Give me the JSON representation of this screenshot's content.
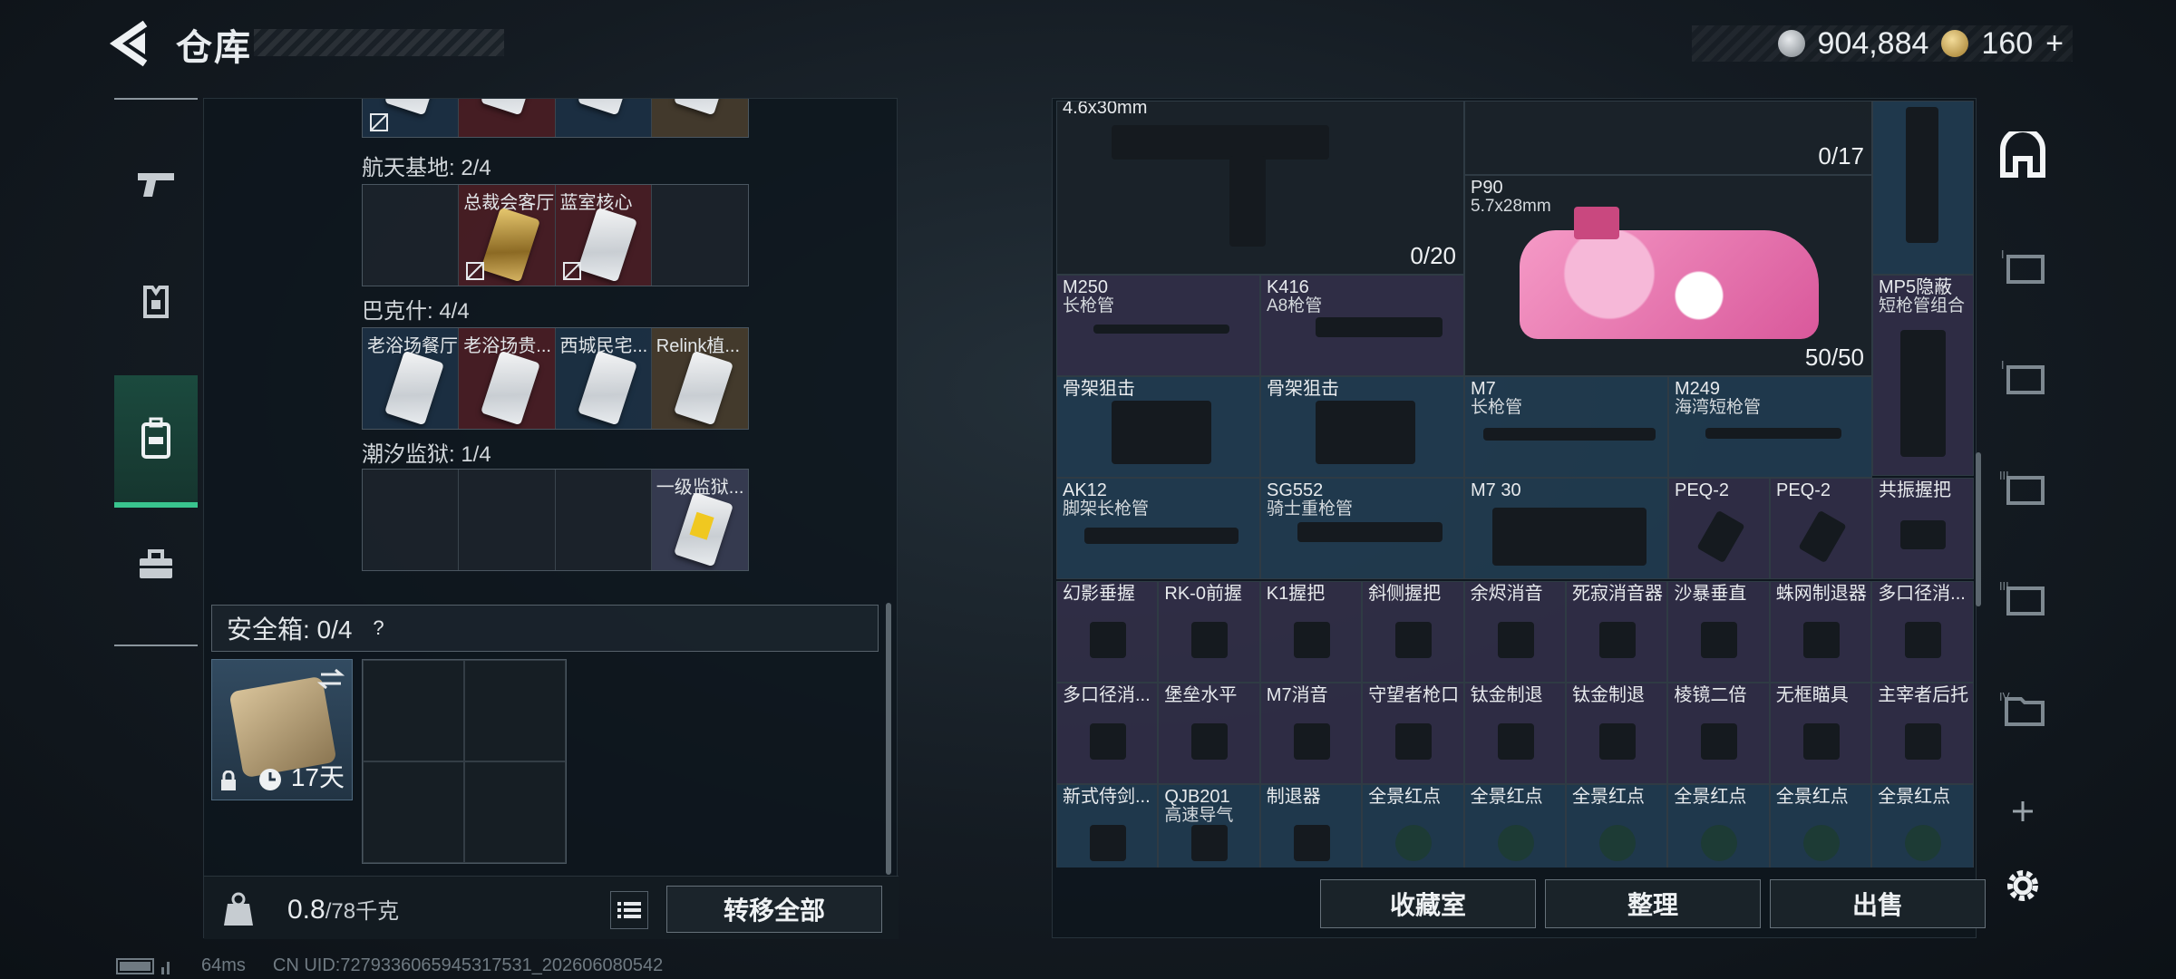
{
  "header": {
    "title": "仓库",
    "silver_amount": "904,884",
    "gold_amount": "160",
    "gold_plus": "+"
  },
  "left": {
    "sections": [
      {
        "label": "航天基地: 2/4",
        "cards": [
          "",
          "总裁会客厅",
          "蓝室核心",
          ""
        ]
      },
      {
        "label": "巴克什: 4/4",
        "cards": [
          "老浴场餐厅",
          "老浴场贵...",
          "西城民宅...",
          "Relink植..."
        ]
      },
      {
        "label": "潮汐监狱: 1/4",
        "cards": [
          "",
          "",
          "",
          "一级监狱..."
        ]
      }
    ],
    "safe_label": "安全箱: 0/4",
    "help": "?",
    "safe_days": "17天",
    "weight_value": "0.8",
    "weight_max": "/78千克",
    "transfer_all": "转移全部"
  },
  "inventory": {
    "items": [
      {
        "name": "4.6x30mm",
        "sub": "",
        "ammo": "0/20"
      },
      {
        "name": "",
        "sub": "",
        "ammo": "0/17"
      },
      {
        "name": "P90",
        "sub": "5.7x28mm",
        "ammo": "50/50"
      },
      {
        "name": "M250",
        "sub": "长枪管"
      },
      {
        "name": "K416",
        "sub": "A8枪管"
      },
      {
        "name": "MP5隐蔽",
        "sub": "短枪管组合"
      },
      {
        "name": "骨架狙击",
        "sub": ""
      },
      {
        "name": "骨架狙击",
        "sub": ""
      },
      {
        "name": "M7",
        "sub": "长枪管"
      },
      {
        "name": "M249",
        "sub": "海湾短枪管"
      },
      {
        "name": "AK12",
        "sub": "脚架长枪管"
      },
      {
        "name": "SG552",
        "sub": "骑士重枪管"
      },
      {
        "name": "M7 30",
        "sub": ""
      },
      {
        "name": "PEQ-2",
        "sub": ""
      },
      {
        "name": "PEQ-2",
        "sub": ""
      },
      {
        "name": "共振握把",
        "sub": ""
      },
      {
        "name": "幻影垂握",
        "sub": ""
      },
      {
        "name": "RK-0前握",
        "sub": ""
      },
      {
        "name": "K1握把",
        "sub": ""
      },
      {
        "name": "斜侧握把",
        "sub": ""
      },
      {
        "name": "余烬消音",
        "sub": ""
      },
      {
        "name": "死寂消音器",
        "sub": ""
      },
      {
        "name": "沙暴垂直",
        "sub": ""
      },
      {
        "name": "蛛网制退器",
        "sub": ""
      },
      {
        "name": "多口径消...",
        "sub": ""
      },
      {
        "name": "多口径消...",
        "sub": ""
      },
      {
        "name": "堡垒水平",
        "sub": ""
      },
      {
        "name": "M7消音",
        "sub": ""
      },
      {
        "name": "守望者枪口",
        "sub": ""
      },
      {
        "name": "钛金制退",
        "sub": ""
      },
      {
        "name": "钛金制退",
        "sub": ""
      },
      {
        "name": "棱镜二倍",
        "sub": ""
      },
      {
        "name": "无框瞄具",
        "sub": ""
      },
      {
        "name": "主宰者后托",
        "sub": ""
      },
      {
        "name": "新式侍剑...",
        "sub": ""
      },
      {
        "name": "QJB201",
        "sub": "高速导气"
      },
      {
        "name": "制退器",
        "sub": ""
      },
      {
        "name": "全景红点",
        "sub": ""
      },
      {
        "name": "全景红点",
        "sub": ""
      },
      {
        "name": "全景红点",
        "sub": ""
      },
      {
        "name": "全景红点",
        "sub": ""
      },
      {
        "name": "全景红点",
        "sub": ""
      },
      {
        "name": "全景红点",
        "sub": ""
      }
    ],
    "buttons": {
      "collection": "收藏室",
      "sort": "整理",
      "sell": "出售"
    }
  },
  "status": {
    "ping": "64ms",
    "uid": "CN UID:7279336065945317531_202606080542"
  }
}
